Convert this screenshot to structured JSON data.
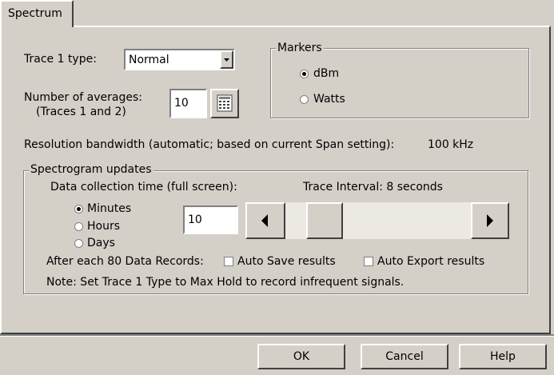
{
  "tab": {
    "label": "Spectrum"
  },
  "trace": {
    "type_label": "Trace 1 type:",
    "type_value": "Normal",
    "averages_label_1": "Number of averages:",
    "averages_label_2": "(Traces 1 and 2)",
    "averages_value": "10"
  },
  "markers": {
    "title": "Markers",
    "options": [
      "dBm",
      "Watts"
    ],
    "selected": "dBm"
  },
  "resolution": {
    "label": "Resolution bandwidth (automatic; based on current Span setting):",
    "value": "100 kHz"
  },
  "spectrogram": {
    "title": "Spectrogram updates",
    "collection_label": "Data collection time (full screen):",
    "interval_text": "Trace Interval: 8 seconds",
    "time_options": [
      "Minutes",
      "Hours",
      "Days"
    ],
    "selected_time": "Minutes",
    "time_value": "10",
    "slider_position": 0.14,
    "records_label": "After each 80 Data Records:",
    "auto_save_label": "Auto Save results",
    "auto_export_label": "Auto Export results",
    "auto_save_checked": false,
    "auto_export_checked": false,
    "note": "Note: Set Trace 1 Type to Max Hold to record infrequent signals."
  },
  "buttons": {
    "ok": "OK",
    "cancel": "Cancel",
    "help": "Help"
  },
  "icons": {
    "dropdown": "chevron-down-icon",
    "keypad": "keypad-icon",
    "left": "arrow-left-icon",
    "right": "arrow-right-icon"
  }
}
